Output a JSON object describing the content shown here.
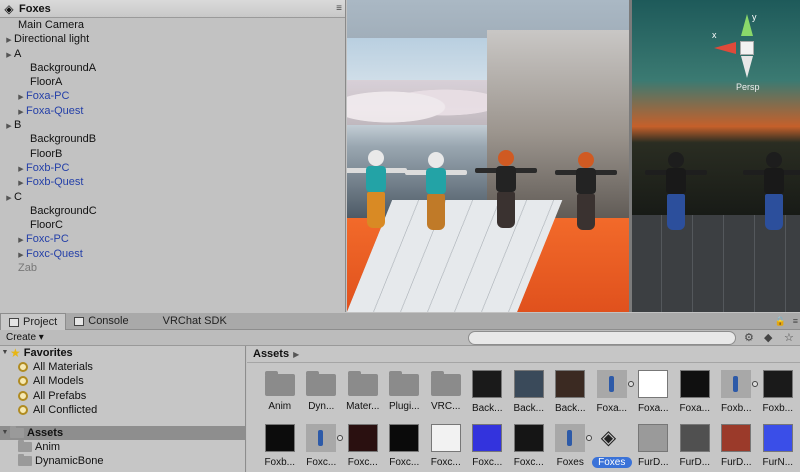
{
  "hierarchy": {
    "title": "Foxes",
    "items": [
      {
        "label": "Main Camera",
        "indent": 1,
        "type": "normal",
        "arrow": false
      },
      {
        "label": "Directional light",
        "indent": 0,
        "type": "normal",
        "arrow": true
      },
      {
        "label": "A",
        "indent": 0,
        "type": "normal",
        "arrow": true
      },
      {
        "label": "BackgroundA",
        "indent": 2,
        "type": "normal",
        "arrow": false
      },
      {
        "label": "FloorA",
        "indent": 2,
        "type": "normal",
        "arrow": false
      },
      {
        "label": "Foxa-PC",
        "indent": 1,
        "type": "prefab",
        "arrow": true
      },
      {
        "label": "Foxa-Quest",
        "indent": 1,
        "type": "prefab",
        "arrow": true
      },
      {
        "label": "B",
        "indent": 0,
        "type": "normal",
        "arrow": true
      },
      {
        "label": "BackgroundB",
        "indent": 2,
        "type": "normal",
        "arrow": false
      },
      {
        "label": "FloorB",
        "indent": 2,
        "type": "normal",
        "arrow": false
      },
      {
        "label": "Foxb-PC",
        "indent": 1,
        "type": "prefab",
        "arrow": true
      },
      {
        "label": "Foxb-Quest",
        "indent": 1,
        "type": "prefab",
        "arrow": true
      },
      {
        "label": "C",
        "indent": 0,
        "type": "normal",
        "arrow": true
      },
      {
        "label": "BackgroundC",
        "indent": 2,
        "type": "normal",
        "arrow": false
      },
      {
        "label": "FloorC",
        "indent": 2,
        "type": "normal",
        "arrow": false
      },
      {
        "label": "Foxc-PC",
        "indent": 1,
        "type": "prefab",
        "arrow": true
      },
      {
        "label": "Foxc-Quest",
        "indent": 1,
        "type": "prefab",
        "arrow": true
      },
      {
        "label": "Zab",
        "indent": 1,
        "type": "inactive",
        "arrow": false
      }
    ]
  },
  "scene": {
    "gizmo": {
      "x_label": "x",
      "y_label": "y",
      "persp_label": "Persp"
    }
  },
  "tabs": [
    {
      "label": "Project",
      "active": true,
      "icon": "project-tab-icon"
    },
    {
      "label": "Console",
      "active": false,
      "icon": "console-tab-icon"
    },
    {
      "label": "VRChat SDK",
      "active": false,
      "icon": ""
    }
  ],
  "toolbar": {
    "create_label": "Create",
    "search_placeholder": ""
  },
  "tree": {
    "favorites_label": "Favorites",
    "favorites": [
      "All Materials",
      "All Models",
      "All Prefabs",
      "All Conflicted"
    ],
    "assets_label": "Assets",
    "asset_folders": [
      "Anim",
      "DynamicBone"
    ]
  },
  "assets_panel": {
    "header": "Assets",
    "row1": [
      {
        "label": "Anim",
        "kind": "folder"
      },
      {
        "label": "Dyn...",
        "kind": "folder"
      },
      {
        "label": "Mater...",
        "kind": "folder"
      },
      {
        "label": "Plugi...",
        "kind": "folder"
      },
      {
        "label": "VRC...",
        "kind": "folder"
      },
      {
        "label": "Back...",
        "kind": "img",
        "color": "#1a1a1a"
      },
      {
        "label": "Back...",
        "kind": "img",
        "color": "#3a4a5a"
      },
      {
        "label": "Back...",
        "kind": "img",
        "color": "#3b2a22"
      },
      {
        "label": "Foxa...",
        "kind": "model",
        "color": "#a8a8a8"
      },
      {
        "label": "Foxa...",
        "kind": "img",
        "color": "#ffffff"
      },
      {
        "label": "Foxa...",
        "kind": "img",
        "color": "#101010"
      },
      {
        "label": "Foxb...",
        "kind": "model",
        "color": "#a8a8a8"
      },
      {
        "label": "Foxb...",
        "kind": "img",
        "color": "#1a1a1a"
      }
    ],
    "row2": [
      {
        "label": "Foxb...",
        "kind": "img",
        "color": "#0c0c0c"
      },
      {
        "label": "Foxc...",
        "kind": "model",
        "color": "#a8a8a8"
      },
      {
        "label": "Foxc...",
        "kind": "img",
        "color": "#2a1010"
      },
      {
        "label": "Foxc...",
        "kind": "img",
        "color": "#0a0a0a"
      },
      {
        "label": "Foxc...",
        "kind": "img",
        "color": "#f2f2f2"
      },
      {
        "label": "Foxc...",
        "kind": "img",
        "color": "#3333dd"
      },
      {
        "label": "Foxc...",
        "kind": "img",
        "color": "#151515"
      },
      {
        "label": "Foxes",
        "kind": "model",
        "color": "#a8a8a8"
      },
      {
        "label": "Foxes",
        "kind": "unity",
        "color": "#c6c6c6",
        "selected": true
      },
      {
        "label": "FurD...",
        "kind": "img",
        "color": "#9a9a9a"
      },
      {
        "label": "FurD...",
        "kind": "img",
        "color": "#505050"
      },
      {
        "label": "FurD...",
        "kind": "img",
        "color": "#9b3a2a"
      },
      {
        "label": "FurN...",
        "kind": "img",
        "color": "#3a4ee8"
      }
    ]
  }
}
